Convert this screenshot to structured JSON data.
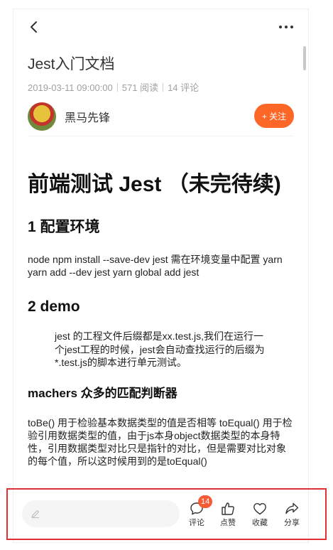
{
  "article": {
    "title": "Jest入门文档",
    "date": "2019-03-11 09:00:00",
    "reads": "571 阅读",
    "comments": "14 评论",
    "author": "黑马先锋",
    "follow_label": "+ 关注"
  },
  "body": {
    "h1": "前端测试 Jest （未完待续)",
    "section1_title": "1 配置环境",
    "section1_text": "node npm install --save-dev jest 需在环境变量中配置 yarn yarn add --dev jest yarn global add jest",
    "section2_title": "2 demo",
    "quote": "jest 的工程文件后缀都是xx.test.js,我们在运行一个jest工程的时候，jest会自动查找运行的后缀为*.test.js的脚本进行单元测试。",
    "section3_title": "machers 众多的匹配判断器",
    "section3_text": "toBe() 用于检验基本数据类型的值是否相等 toEqual() 用于检验引用数据类型的值，由于js本身object数据类型的本身特性，引用数据类型对比只是指针的对比，但是需要对比对象的每个值，所以这时候用到的是toEqual()"
  },
  "bottom_bar": {
    "comment_badge": "14",
    "comment_label": "评论",
    "like_label": "点赞",
    "collect_label": "收藏",
    "share_label": "分享"
  },
  "colors": {
    "accent": "#fc6627",
    "badge": "#f65b36",
    "highlight": "#e23131"
  }
}
